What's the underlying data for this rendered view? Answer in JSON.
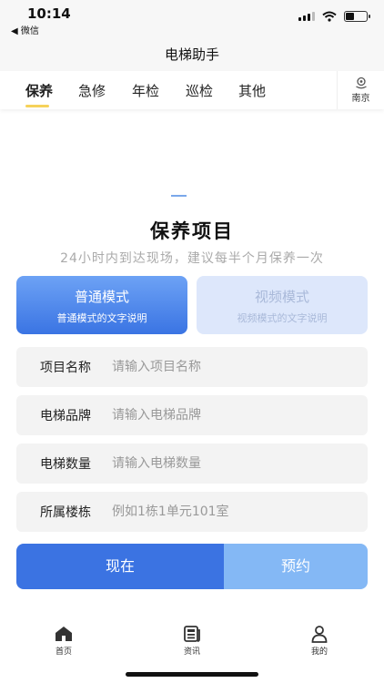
{
  "status_bar": {
    "time": "10:14",
    "back_app": "◀ 微信"
  },
  "header": {
    "title": "电梯助手"
  },
  "tabs": [
    {
      "label": "保养",
      "active": true
    },
    {
      "label": "急修",
      "active": false
    },
    {
      "label": "年检",
      "active": false
    },
    {
      "label": "巡检",
      "active": false
    },
    {
      "label": "其他",
      "active": false
    }
  ],
  "location": {
    "icon": "location-icon",
    "label": "南京"
  },
  "section": {
    "title": "保养项目",
    "subtitle": "24小时内到达现场，建议每半个月保养一次"
  },
  "modes": [
    {
      "name": "普通模式",
      "description": "普通模式的文字说明",
      "selected": true
    },
    {
      "name": "视频模式",
      "description": "视频模式的文字说明",
      "selected": false
    }
  ],
  "form": {
    "fields": [
      {
        "label": "项目名称",
        "placeholder": "请输入项目名称",
        "value": ""
      },
      {
        "label": "电梯品牌",
        "placeholder": "请输入电梯品牌",
        "value": ""
      },
      {
        "label": "电梯数量",
        "placeholder": "请输入电梯数量",
        "value": ""
      },
      {
        "label": "所属楼栋",
        "placeholder": "例如1栋1单元101室",
        "value": ""
      }
    ]
  },
  "actions": {
    "now_label": "现在",
    "book_label": "预约"
  },
  "tabbar": [
    {
      "label": "首页",
      "icon": "home-icon"
    },
    {
      "label": "资讯",
      "icon": "news-icon"
    },
    {
      "label": "我的",
      "icon": "user-icon"
    }
  ],
  "colors": {
    "primary": "#3b73e2",
    "secondary": "#84b8f5",
    "accent": "#f6d25a"
  }
}
